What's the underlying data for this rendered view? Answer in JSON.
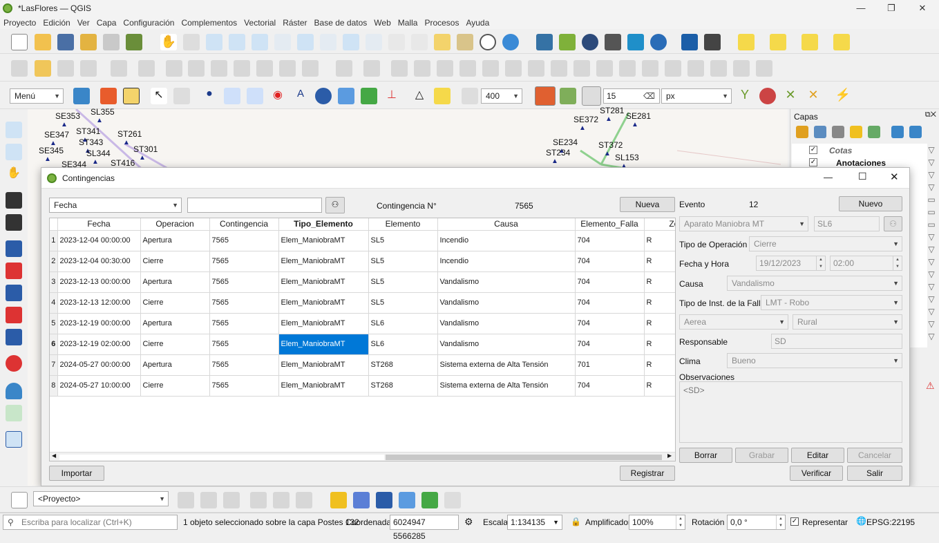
{
  "window": {
    "title": "*LasFlores — QGIS"
  },
  "menu": [
    "Proyecto",
    "Edición",
    "Ver",
    "Capa",
    "Configuración",
    "Complementos",
    "Vectorial",
    "Ráster",
    "Base de datos",
    "Web",
    "Malla",
    "Procesos",
    "Ayuda"
  ],
  "digitize_toolbar": {
    "menu_label": "Menú",
    "scale_value": "400",
    "tolerance_value": "15",
    "units": "px"
  },
  "map_labels": [
    {
      "text": "SE353"
    },
    {
      "text": "SL355"
    },
    {
      "text": "ST341"
    },
    {
      "text": "SE347"
    },
    {
      "text": "ST343"
    },
    {
      "text": "ST261"
    },
    {
      "text": "SE345"
    },
    {
      "text": "SL344"
    },
    {
      "text": "ST301"
    },
    {
      "text": "SE344"
    },
    {
      "text": "ST416"
    },
    {
      "text": "SE372"
    },
    {
      "text": "ST281"
    },
    {
      "text": "SE281"
    },
    {
      "text": "SE234"
    },
    {
      "text": "ST372"
    },
    {
      "text": "ST234"
    },
    {
      "text": "SL153"
    }
  ],
  "layers_panel": {
    "title": "Capas",
    "items": [
      {
        "label": "Cotas"
      },
      {
        "label": "Anotaciones"
      }
    ]
  },
  "dialog": {
    "title": "Contingencias",
    "filter_field": "Fecha",
    "filter_text": "",
    "contingencia_label": "Contingencia N°",
    "contingencia_value": "7565",
    "nueva_label": "Nueva",
    "columns": [
      "Fecha",
      "Operacion",
      "Contingencia",
      "Tipo_Elemento",
      "Elemento",
      "Causa",
      "Elemento_Falla",
      "Zona"
    ],
    "rows": [
      {
        "n": "1",
        "fecha": "2023-12-04 00:00:00",
        "operacion": "Apertura",
        "contingencia": "7565",
        "tipo": "Elem_ManiobraMT",
        "elemento": "SL5",
        "causa": "Incendio",
        "falla": "704",
        "zona": "R"
      },
      {
        "n": "2",
        "fecha": "2023-12-04 00:30:00",
        "operacion": "Cierre",
        "contingencia": "7565",
        "tipo": "Elem_ManiobraMT",
        "elemento": "SL5",
        "causa": "Incendio",
        "falla": "704",
        "zona": "R"
      },
      {
        "n": "3",
        "fecha": "2023-12-13 00:00:00",
        "operacion": "Apertura",
        "contingencia": "7565",
        "tipo": "Elem_ManiobraMT",
        "elemento": "SL5",
        "causa": "Vandalismo",
        "falla": "704",
        "zona": "R"
      },
      {
        "n": "4",
        "fecha": "2023-12-13 12:00:00",
        "operacion": "Cierre",
        "contingencia": "7565",
        "tipo": "Elem_ManiobraMT",
        "elemento": "SL5",
        "causa": "Vandalismo",
        "falla": "704",
        "zona": "R"
      },
      {
        "n": "5",
        "fecha": "2023-12-19 00:00:00",
        "operacion": "Apertura",
        "contingencia": "7565",
        "tipo": "Elem_ManiobraMT",
        "elemento": "SL6",
        "causa": "Vandalismo",
        "falla": "704",
        "zona": "R"
      },
      {
        "n": "6",
        "fecha": "2023-12-19 02:00:00",
        "operacion": "Cierre",
        "contingencia": "7565",
        "tipo": "Elem_ManiobraMT",
        "elemento": "SL6",
        "causa": "Vandalismo",
        "falla": "704",
        "zona": "R"
      },
      {
        "n": "7",
        "fecha": "2024-05-27 00:00:00",
        "operacion": "Apertura",
        "contingencia": "7565",
        "tipo": "Elem_ManiobraMT",
        "elemento": "ST268",
        "causa": "Sistema externa de Alta Tensión",
        "falla": "701",
        "zona": "R"
      },
      {
        "n": "8",
        "fecha": "2024-05-27 10:00:00",
        "operacion": "Cierre",
        "contingencia": "7565",
        "tipo": "Elem_ManiobraMT",
        "elemento": "ST268",
        "causa": "Sistema externa de Alta Tensión",
        "falla": "704",
        "zona": "R"
      }
    ],
    "importar_label": "Importar",
    "registrar_label": "Registrar",
    "evento_label": "Evento",
    "evento_value": "12",
    "nuevo_label": "Nuevo",
    "elemento_tipo": "Aparato Maniobra MT",
    "elemento_id": "SL6",
    "tipo_operacion_label": "Tipo de Operación",
    "tipo_operacion": "Cierre",
    "fecha_hora_label": "Fecha y Hora",
    "fecha": "19/12/2023",
    "hora": "02:00",
    "causa_label": "Causa",
    "causa": "Vandalismo",
    "tipo_inst_label": "Tipo de Inst. de la Falla",
    "tipo_inst": "LMT - Robo",
    "ubicacion": "Aerea",
    "zona": "Rural",
    "responsable_label": "Responsable",
    "responsable": "SD",
    "clima_label": "Clima",
    "clima": "Bueno",
    "observaciones_label": "Observaciones",
    "observaciones": "<SD>",
    "borrar_label": "Borrar",
    "grabar_label": "Grabar",
    "editar_label": "Editar",
    "cancelar_label": "Cancelar",
    "verificar_label": "Verificar",
    "salir_label": "Salir"
  },
  "bottom_toolbar": {
    "project_combo": "<Proyecto>"
  },
  "status": {
    "search_placeholder": "Escriba para localizar (Ctrl+K)",
    "message": "1 objeto seleccionado sobre la capa Postes 132",
    "coord_label": "Coordenada",
    "coord_value": "6024947  5566285",
    "escala_label": "Escala",
    "escala_value": "1:134135",
    "amplificador_label": "Amplificador",
    "amplificador_value": "100%",
    "rotacion_label": "Rotación",
    "rotacion_value": "0,0 °",
    "representar_label": "Representar",
    "crs": "EPSG:22195"
  }
}
